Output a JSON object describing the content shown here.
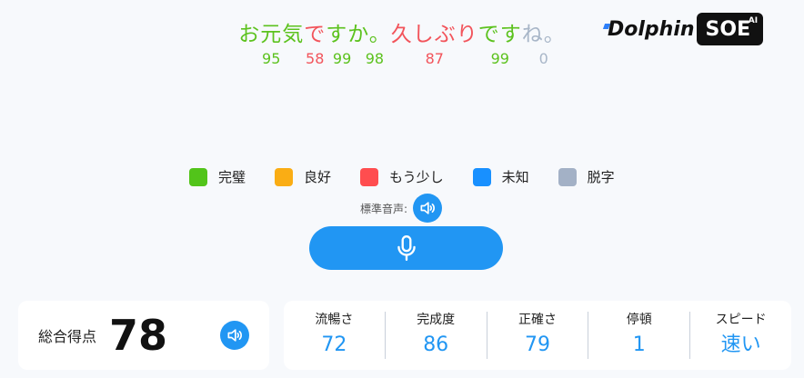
{
  "sentence": {
    "chunks": [
      {
        "text": "お元気",
        "status": "perfect",
        "scores": [
          "95"
        ]
      },
      {
        "text": "で",
        "status": "bad",
        "scores": [
          "58"
        ]
      },
      {
        "text": "すか。",
        "status": "perfect",
        "scores": [
          "99",
          "98"
        ]
      },
      {
        "text": "久しぶり",
        "status": "bad",
        "scores": [
          "87"
        ]
      },
      {
        "text": "です",
        "status": "perfect",
        "scores": [
          "99"
        ]
      },
      {
        "text": "ね。",
        "status": "missing",
        "scores": [
          "0"
        ]
      }
    ]
  },
  "logo": {
    "word": "Dolphin",
    "badge": "SOE",
    "badge_sup": "AI"
  },
  "legend": [
    {
      "label": "完璧",
      "color": "#52c41a"
    },
    {
      "label": "良好",
      "color": "#faad14"
    },
    {
      "label": "もう少し",
      "color": "#ff4d4f"
    },
    {
      "label": "未知",
      "color": "#1890ff"
    },
    {
      "label": "脱字",
      "color": "#a3b1c6"
    }
  ],
  "standard_audio": {
    "label": "標準音声:",
    "icon": "speaker-icon"
  },
  "mic": {
    "icon": "microphone-icon"
  },
  "total": {
    "label": "総合得点",
    "value": "78",
    "icon": "speaker-icon"
  },
  "metrics": [
    {
      "label": "流暢さ",
      "value": "72"
    },
    {
      "label": "完成度",
      "value": "86"
    },
    {
      "label": "正確さ",
      "value": "79"
    },
    {
      "label": "停頓",
      "value": "1"
    },
    {
      "label": "スピード",
      "value": "速い"
    }
  ],
  "colors": {
    "accent": "#2196f3",
    "perfect": "#5cc21e",
    "bad": "#f2545b",
    "missing": "#a8b6c8"
  }
}
